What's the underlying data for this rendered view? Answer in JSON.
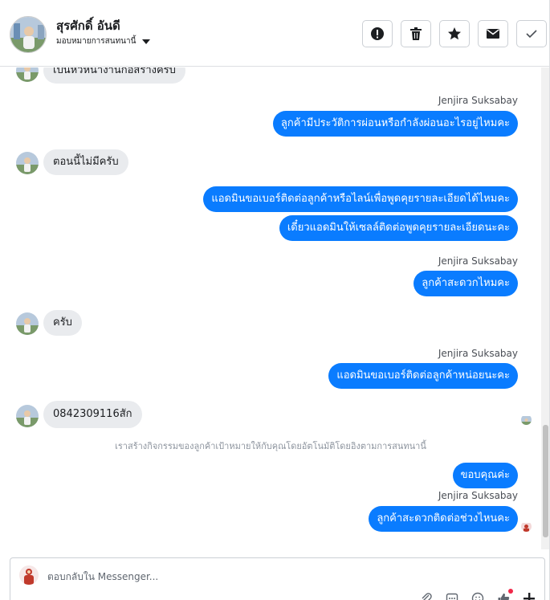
{
  "header": {
    "contact_name": "สุรศักดิ์ อันดี",
    "assign_label": "มอบหมายการสนทนานี้"
  },
  "actions": [
    {
      "name": "mark-spam",
      "icon": "alert-icon"
    },
    {
      "name": "delete",
      "icon": "trash-icon"
    },
    {
      "name": "star",
      "icon": "star-icon"
    },
    {
      "name": "mark-unread",
      "icon": "mail-icon"
    },
    {
      "name": "mark-done",
      "icon": "check-icon"
    }
  ],
  "messages": {
    "m0": "เป็นหัวหน้างานก่อสร้างครับ",
    "s1": "Jenjira Suksabay",
    "m1": "ลูกค้ามีประวัติการผ่อนหรือกำลังผ่อนอะไรอยู่ไหมคะ",
    "m2": "ตอนนี้ไม่มีครับ",
    "m3": "แอดมินขอเบอร์ติดต่อลูกค้าหรือไลน์เพื่อพูดคุยรายละเอียดได้ไหมคะ",
    "m4": "เดี๋ยวแอดมินให้เซลล์ติดต่อพูดคุยรายละเอียดนะคะ",
    "s2": "Jenjira Suksabay",
    "m5": "ลูกค้าสะดวกไหมคะ",
    "m6": "ครับ",
    "s3": "Jenjira Suksabay",
    "m7": "แอดมินขอเบอร์ติดต่อลูกค้าหน่อยนะคะ",
    "m8": "0842309116สัก",
    "system_note": "เราสร้างกิจกรรมของลูกค้าเป้าหมายให้กับคุณโดยอัตโนมัติโดยอิงตามการสนทนานี้",
    "m9": "ขอบคุณค่ะ",
    "s4": "Jenjira Suksabay",
    "m10": "ลูกค้าสะดวกติดต่อช่วงไหนคะ"
  },
  "composer": {
    "placeholder": "ตอบกลับใน Messenger..."
  },
  "colors": {
    "outgoing_bubble": "#0a7cff",
    "incoming_bubble": "#e9ebee",
    "notification_dot": "#f02849"
  }
}
